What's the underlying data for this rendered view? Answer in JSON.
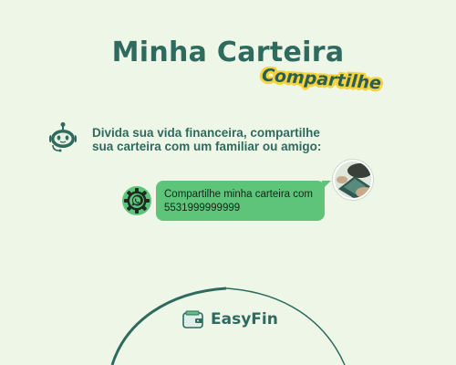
{
  "header": {
    "title": "Minha Carteira",
    "sticker": "Compartilhe"
  },
  "intro": {
    "line1": "Divida sua vida financeira, compartilhe",
    "line2": "sua carteira com um familiar ou amigo:"
  },
  "chat": {
    "message_line1": "Compartilhe minha carteira com",
    "message_line2": "5531999999999"
  },
  "brand": {
    "name": "EasyFin"
  },
  "colors": {
    "background": "#eef6e8",
    "primary": "#2e6b5e",
    "bubble": "#5ec47a",
    "sticker": "#f5d33a"
  },
  "icons": [
    "robot-icon",
    "whatsapp-icon",
    "wallet-icon",
    "user-avatar"
  ]
}
